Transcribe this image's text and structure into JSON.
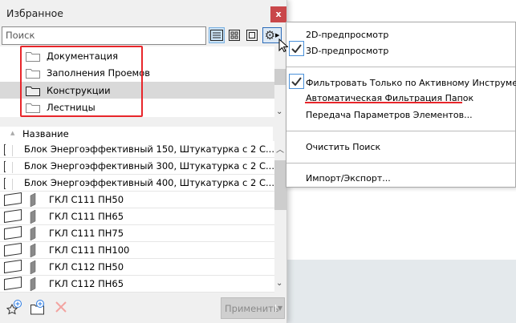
{
  "panel": {
    "title": "Избранное",
    "close_label": "x",
    "search_placeholder": "Поиск"
  },
  "folders": [
    {
      "label": "Документация"
    },
    {
      "label": "Заполнения Проемов"
    },
    {
      "label": "Конструкции",
      "selected": true
    },
    {
      "label": "Лестницы"
    }
  ],
  "list": {
    "column_header": "Название",
    "items": [
      {
        "name": "Блок Энергоэффективный 150, Штукатурка с 2 С...",
        "color": "#777777"
      },
      {
        "name": "Блок Энергоэффективный 300, Штукатурка с 2 С...",
        "color": "#8a7a5e"
      },
      {
        "name": "Блок Энергоэффективный 400, Штукатурка с 2 С...",
        "color": "#a58a4a"
      },
      {
        "name": "ГКЛ С111 ПН50",
        "color": "#8a8a8a"
      },
      {
        "name": "ГКЛ С111 ПН65",
        "color": "#8a8a8a"
      },
      {
        "name": "ГКЛ С111 ПН75",
        "color": "#8a8a8a"
      },
      {
        "name": "ГКЛ С111 ПН100",
        "color": "#8a8a8a"
      },
      {
        "name": "ГКЛ С112 ПН50",
        "color": "#8a8a8a"
      },
      {
        "name": "ГКЛ С112 ПН65",
        "color": "#8a8a8a"
      }
    ]
  },
  "footer": {
    "apply_label": "Применить"
  },
  "menu": {
    "items": [
      {
        "label": "2D-предпросмотр",
        "checked": false
      },
      {
        "label": "3D-предпросмотр",
        "checked": true
      },
      {
        "label": "Фильтровать Только по Активному Инструменту",
        "checked": true
      },
      {
        "label": "Автоматическая Фильтрация Папок",
        "checked": false
      },
      {
        "label": "Передача Параметров Элементов...",
        "checked": false
      },
      {
        "label": "Очистить Поиск",
        "checked": false
      },
      {
        "label": "Импорт/Экспорт...",
        "checked": false
      }
    ]
  },
  "colors": {
    "accent": "#e8262b",
    "close": "#c9474a",
    "check": "#4a90d9"
  }
}
